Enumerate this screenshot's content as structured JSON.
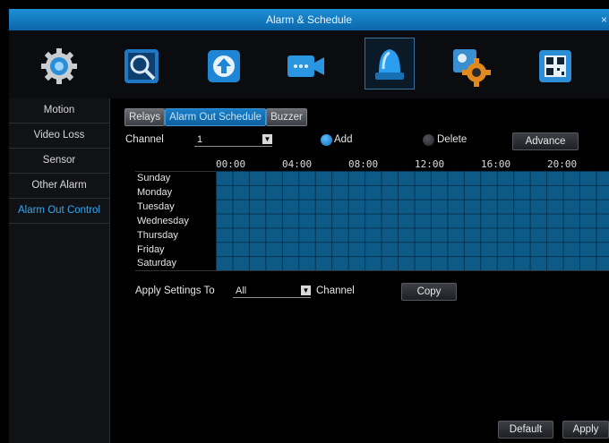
{
  "window": {
    "title": "Alarm & Schedule",
    "close": "×"
  },
  "toolbar": {
    "icons": [
      "system-gear-icon",
      "search-icon",
      "upload-icon",
      "camera-icon",
      "alarm-siren-icon",
      "settings-gear-icon",
      "qr-code-icon"
    ],
    "active": "alarm-siren-icon"
  },
  "sidebar": {
    "items": [
      {
        "label": "Motion"
      },
      {
        "label": "Video Loss"
      },
      {
        "label": "Sensor"
      },
      {
        "label": "Other Alarm"
      },
      {
        "label": "Alarm Out Control"
      }
    ],
    "active_item": "Alarm Out Control"
  },
  "tabs": [
    "Relays",
    "Alarm Out Schedule",
    "Buzzer"
  ],
  "active_tab": "Alarm Out Schedule",
  "channel": {
    "label": "Channel",
    "value": "1"
  },
  "mode": {
    "add": "Add",
    "delete": "Delete",
    "selected": "Add"
  },
  "advance_label": "Advance",
  "schedule": {
    "times": [
      "00:00",
      "04:00",
      "08:00",
      "12:00",
      "16:00",
      "20:00"
    ],
    "days": [
      "Sunday",
      "Monday",
      "Tuesday",
      "Wednesday",
      "Thursday",
      "Friday",
      "Saturday"
    ],
    "all_hours_scheduled": true
  },
  "apply_settings": {
    "label": "Apply Settings To",
    "value": "All",
    "suffix": "Channel"
  },
  "copy_label": "Copy",
  "default_label": "Default",
  "apply_label": "Apply",
  "colors": {
    "accent": "#1a7fc7",
    "schedule_fill": "#0d5a86",
    "active_text": "#37a6f0"
  }
}
